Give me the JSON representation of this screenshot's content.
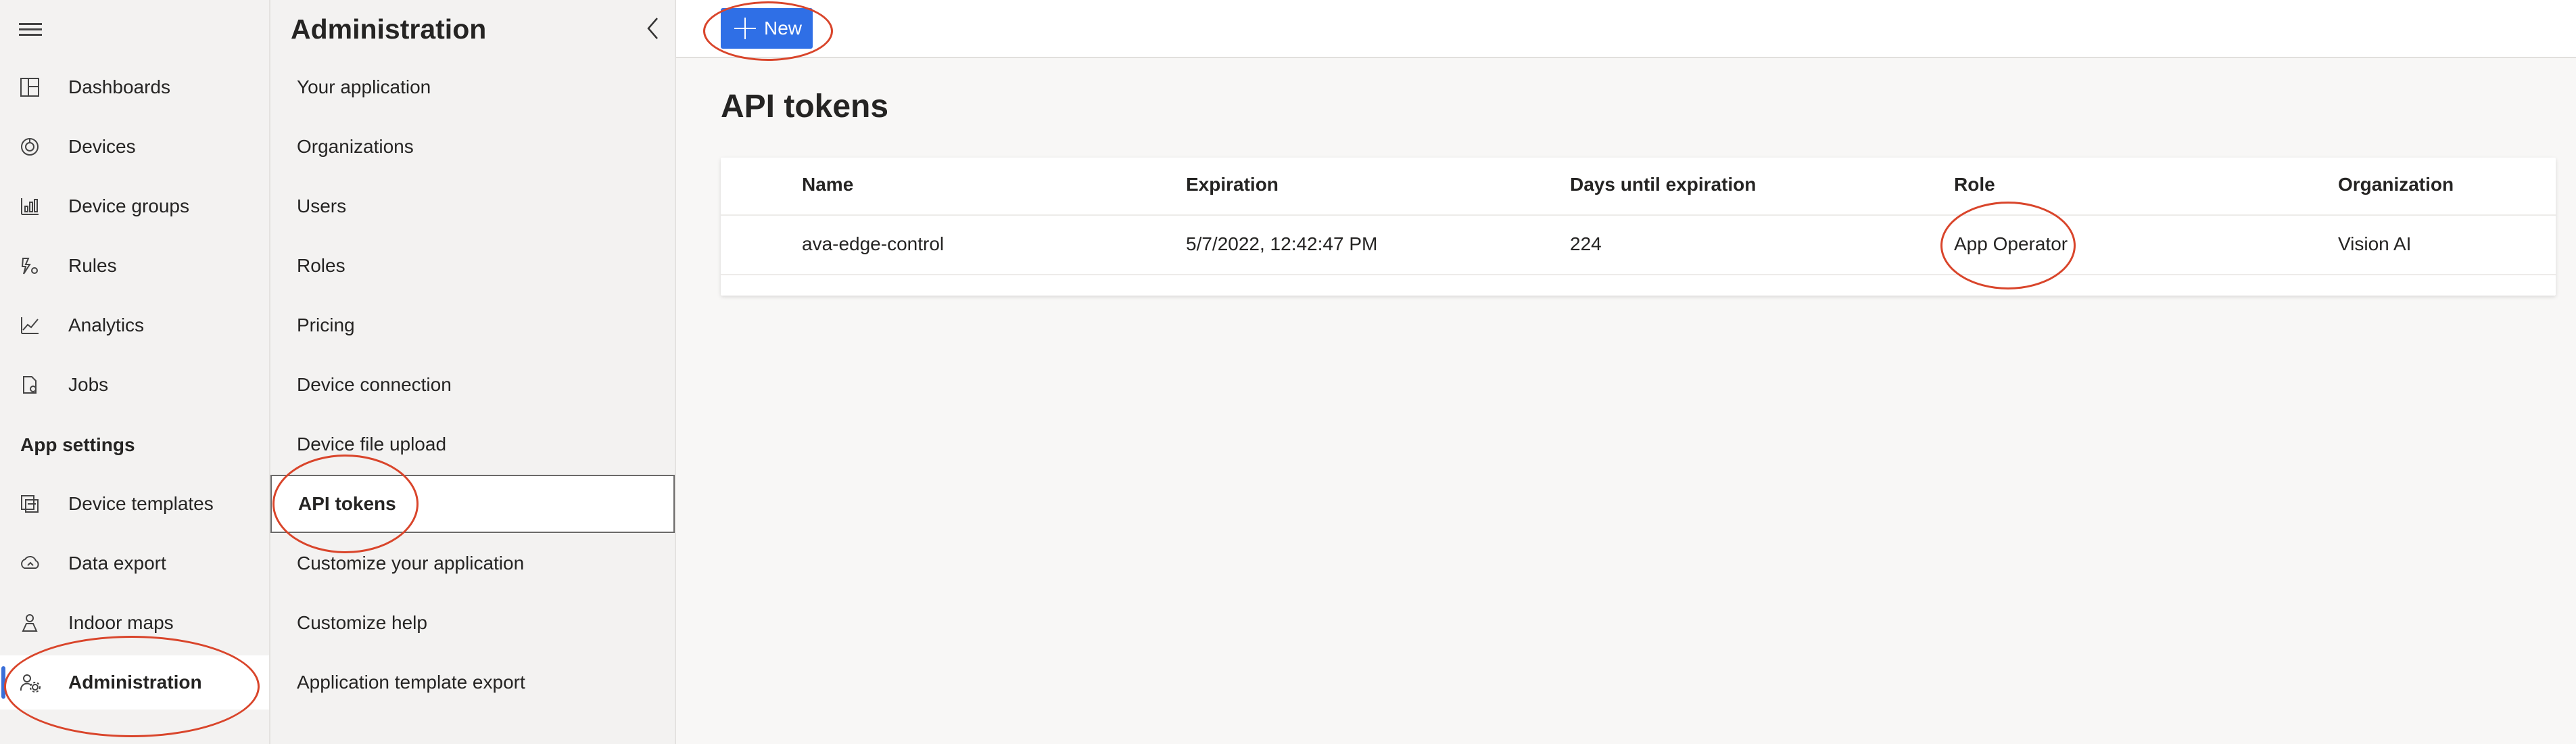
{
  "nav": {
    "items": [
      {
        "label": "Dashboards",
        "icon": "dashboard-icon"
      },
      {
        "label": "Devices",
        "icon": "devices-icon"
      },
      {
        "label": "Device groups",
        "icon": "device-groups-icon"
      },
      {
        "label": "Rules",
        "icon": "rules-icon"
      },
      {
        "label": "Analytics",
        "icon": "analytics-icon"
      },
      {
        "label": "Jobs",
        "icon": "jobs-icon"
      }
    ],
    "section_label": "App settings",
    "settings_items": [
      {
        "label": "Device templates",
        "icon": "device-templates-icon"
      },
      {
        "label": "Data export",
        "icon": "data-export-icon"
      },
      {
        "label": "Indoor maps",
        "icon": "indoor-maps-icon"
      },
      {
        "label": "Administration",
        "icon": "administration-icon",
        "active": true
      }
    ]
  },
  "admin": {
    "title": "Administration",
    "items": [
      {
        "label": "Your application"
      },
      {
        "label": "Organizations"
      },
      {
        "label": "Users"
      },
      {
        "label": "Roles"
      },
      {
        "label": "Pricing"
      },
      {
        "label": "Device connection"
      },
      {
        "label": "Device file upload"
      },
      {
        "label": "API tokens",
        "selected": true
      },
      {
        "label": "Customize your application"
      },
      {
        "label": "Customize help"
      },
      {
        "label": "Application template export"
      }
    ]
  },
  "toolbar": {
    "new_label": "New"
  },
  "main": {
    "title": "API tokens",
    "columns": [
      "Name",
      "Expiration",
      "Days until expiration",
      "Role",
      "Organization"
    ],
    "rows": [
      [
        "ava-edge-control",
        "5/7/2022, 12:42:47 PM",
        "224",
        "App Operator",
        "Vision AI"
      ]
    ]
  },
  "colors": {
    "accent": "#2f6fe6",
    "annotation": "#d9452b"
  }
}
